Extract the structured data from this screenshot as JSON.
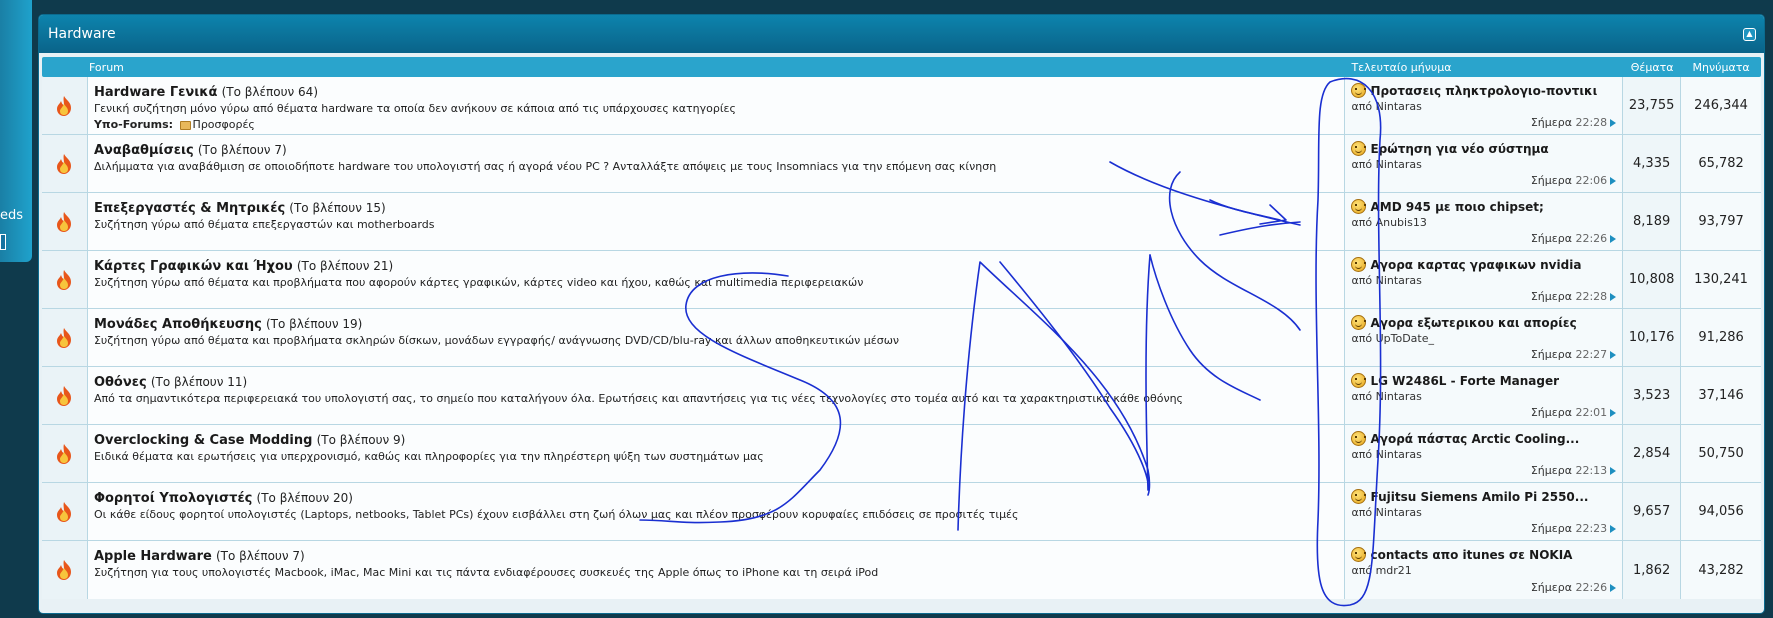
{
  "sidebar": {
    "text": "eds"
  },
  "category": {
    "title": "Hardware"
  },
  "columns": {
    "forum": "Forum",
    "last_post": "Τελευταίο μήνυμα",
    "threads": "Θέματα",
    "posts": "Μηνύματα"
  },
  "forums": [
    {
      "title": "Hardware Γενικά",
      "viewing": "(Το βλέπουν 64)",
      "description": "Γενική συζήτηση μόνο γύρω από θέματα hardware τα οποία δεν ανήκουν σε κάποια από τις υπάρχουσες κατηγορίες",
      "subforums_label": "Υπο-Forums:",
      "subforum": "Προσφορές",
      "last_title": "Προτασεις πληκτρολογιο-ποντικι",
      "last_by": "από Nintaras",
      "last_date": "Σήμερα",
      "last_time": "22:28",
      "threads": "23,755",
      "posts": "246,344"
    },
    {
      "title": "Αναβαθμίσεις",
      "viewing": "(Το βλέπουν 7)",
      "description": "Διλήμματα για αναβάθμιση σε οποιοδήποτε hardware του υπολογιστή σας ή αγορά νέου PC ? Ανταλλάξτε απόψεις με τους Insomniacs για την επόμενη σας κίνηση",
      "last_title": "Ερώτηση για νέο σύστημα",
      "last_by": "από Nintaras",
      "last_date": "Σήμερα",
      "last_time": "22:06",
      "threads": "4,335",
      "posts": "65,782"
    },
    {
      "title": "Επεξεργαστές & Μητρικές",
      "viewing": "(Το βλέπουν 15)",
      "description": "Συζήτηση γύρω από θέματα επεξεργαστών και motherboards",
      "last_title": "AMD 945 με ποιο chipset;",
      "last_by": "από Anubis13",
      "last_date": "Σήμερα",
      "last_time": "22:26",
      "threads": "8,189",
      "posts": "93,797"
    },
    {
      "title": "Κάρτες Γραφικών και Ήχου",
      "viewing": "(Το βλέπουν 21)",
      "description": "Συζήτηση γύρω από θέματα και προβλήματα που αφορούν κάρτες γραφικών, κάρτες video και ήχου, καθώς και multimedia περιφερειακών",
      "last_title": "Αγορα καρτας γραφικων nvidia",
      "last_by": "από Nintaras",
      "last_date": "Σήμερα",
      "last_time": "22:28",
      "threads": "10,808",
      "posts": "130,241"
    },
    {
      "title": "Μονάδες Αποθήκευσης",
      "viewing": "(Το βλέπουν 19)",
      "description": "Συζήτηση γύρω από θέματα και προβλήματα σκληρών δίσκων, μονάδων εγγραφής/ ανάγνωσης DVD/CD/blu-ray και άλλων αποθηκευτικών μέσων",
      "last_title": "Αγορα εξωτερικου και απορίες",
      "last_by": "από UpToDate_",
      "last_date": "Σήμερα",
      "last_time": "22:27",
      "threads": "10,176",
      "posts": "91,286"
    },
    {
      "title": "Οθόνες",
      "viewing": "(Το βλέπουν 11)",
      "description": "Από τα σημαντικότερα περιφερειακά του υπολογιστή σας, το σημείο που καταλήγουν όλα. Ερωτήσεις και απαντήσεις για τις νέες τεχνολογίες στο τομέα αυτό και τα χαρακτηριστικά κάθε οθόνης",
      "last_title": "LG W2486L - Forte Manager",
      "last_by": "από Nintaras",
      "last_date": "Σήμερα",
      "last_time": "22:01",
      "threads": "3,523",
      "posts": "37,146"
    },
    {
      "title": "Overclocking & Case Modding",
      "viewing": "(Το βλέπουν 9)",
      "description": "Ειδικά θέματα και ερωτήσεις για υπερχρονισμό, καθώς και πληροφορίες για την πληρέστερη ψύξη των συστημάτων μας",
      "last_title": "Αγορά πάστας Arctic Cooling...",
      "last_by": "από Nintaras",
      "last_date": "Σήμερα",
      "last_time": "22:13",
      "threads": "2,854",
      "posts": "50,750"
    },
    {
      "title": "Φορητοί Υπολογιστές",
      "viewing": "(Το βλέπουν 20)",
      "description": "Οι κάθε είδους φορητοί υπολογιστές (Laptops, netbooks, Tablet PCs) έχουν εισβάλλει στη ζωή όλων μας και πλέον προσφέρουν κορυφαίες επιδόσεις σε προσιτές τιμές",
      "last_title": "Fujitsu Siemens Amilo Pi 2550...",
      "last_by": "από Nintaras",
      "last_date": "Σήμερα",
      "last_time": "22:23",
      "threads": "9,657",
      "posts": "94,056"
    },
    {
      "title": "Apple Hardware",
      "viewing": "(Το βλέπουν 7)",
      "description": "Συζήτηση για τους υπολογιστές Macbook, iMac, Mac Mini και τις πάντα ενδιαφέρουσες συσκευές της Apple όπως το iPhone και τη σειρά iPod",
      "last_title": "contacts απο itunes σε NOKIA",
      "last_by": "από mdr21",
      "last_date": "Σήμερα",
      "last_time": "22:26",
      "threads": "1,862",
      "posts": "43,282"
    }
  ],
  "colors": {
    "header": "#0a6f96",
    "column_bar": "#2aa4cc",
    "annotation_ink": "#1a2fd1"
  }
}
